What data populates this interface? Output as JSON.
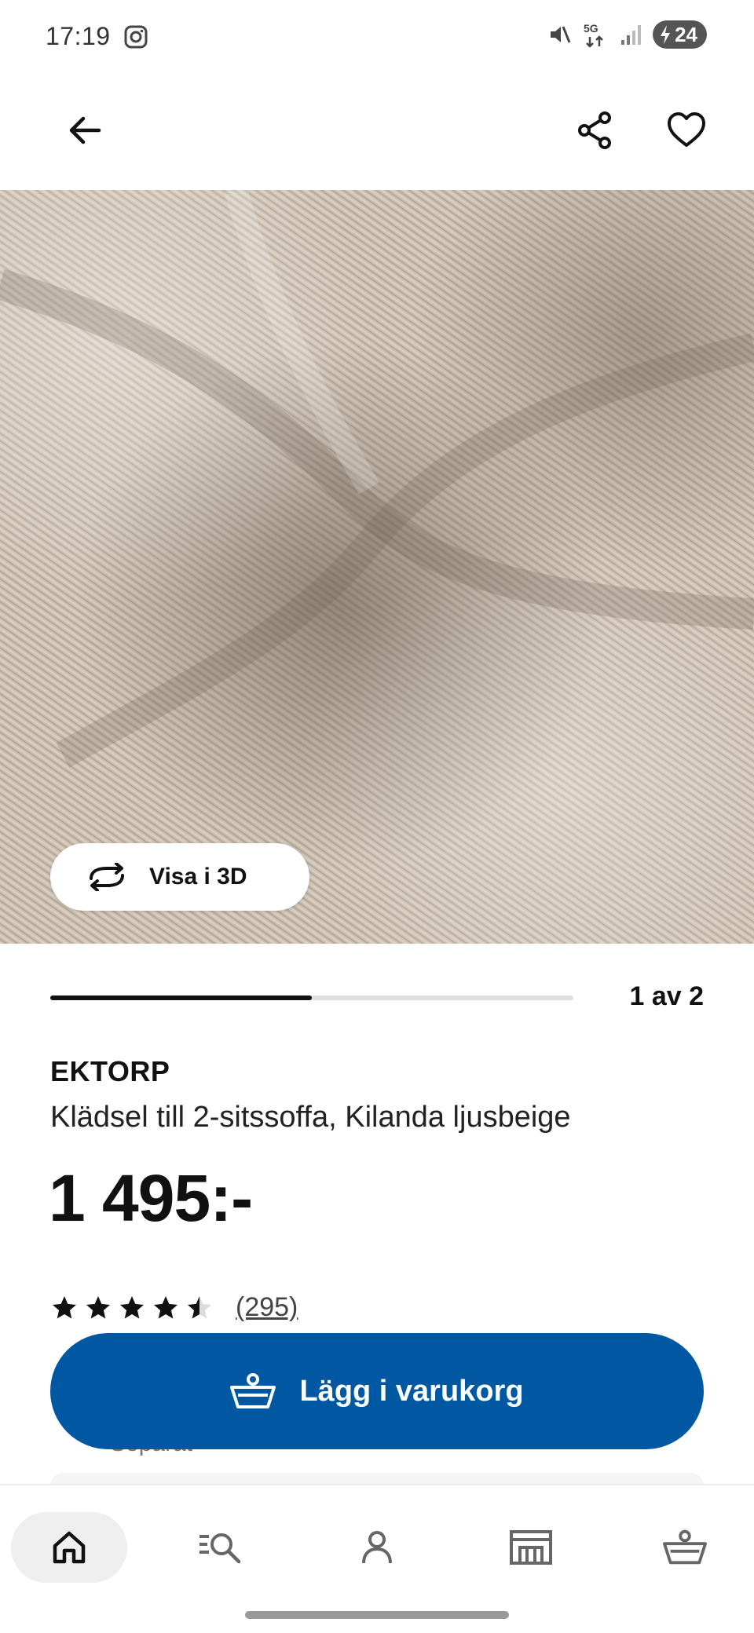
{
  "status_bar": {
    "time": "17:19",
    "network": "5G",
    "battery": "24"
  },
  "top_nav": {
    "back_icon": "arrow-left-icon",
    "share_icon": "share-icon",
    "favorite_icon": "heart-icon"
  },
  "gallery": {
    "view_3d_label": "Visa i 3D",
    "current": 1,
    "total": 2,
    "page_indicator": "1 av 2"
  },
  "product": {
    "name": "EKTORP",
    "description": "Klädsel till 2-sitssoffa, Kilanda ljusbeige",
    "price": "1 495:-",
    "rating": 4.5,
    "rating_max": 5,
    "review_count": "(295)"
  },
  "actions": {
    "add_to_cart_label": "Lägg i varukorg",
    "partially_hidden_text": "Separat"
  },
  "bottom_nav": {
    "items": [
      {
        "icon": "home-icon",
        "active": true
      },
      {
        "icon": "search-list-icon",
        "active": false
      },
      {
        "icon": "profile-icon",
        "active": false
      },
      {
        "icon": "store-icon",
        "active": false
      },
      {
        "icon": "cart-icon",
        "active": false
      }
    ]
  },
  "colors": {
    "primary_blue": "#0058a3",
    "text": "#111111",
    "fabric_beige": "#c9bdaf"
  }
}
